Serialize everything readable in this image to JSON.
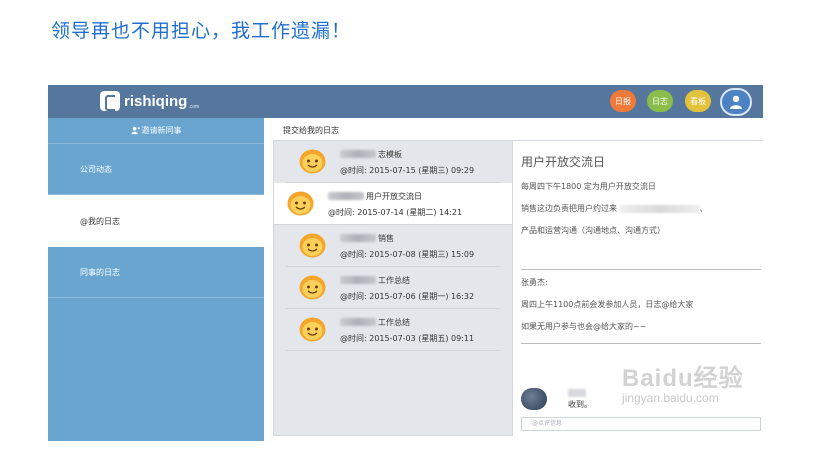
{
  "headline": "领导再也不用担心，我工作遗漏！",
  "topbar": {
    "brand": "rishiqing",
    "brand_suffix": ".com",
    "buttons": [
      "日报",
      "日志",
      "看板"
    ]
  },
  "sidebar": {
    "invite_label": "邀请新同事",
    "items": [
      {
        "label": "公司动态"
      },
      {
        "label": "@我的日志"
      },
      {
        "label": "同事的日志"
      }
    ]
  },
  "list": {
    "title": "提交给我的日志",
    "items": [
      {
        "name": "志模板",
        "time": "@时间: 2015-07-15 (星期三) 09:29"
      },
      {
        "name": "用户开放交流日",
        "time": "@时间: 2015-07-14 (星期二) 14:21"
      },
      {
        "name": "销售",
        "time": "@时间: 2015-07-08 (星期三) 15:09"
      },
      {
        "name": "工作总结",
        "time": "@时间: 2015-07-06 (星期一) 16:32"
      },
      {
        "name": "工作总结",
        "time": "@时间: 2015-07-03 (星期五) 09:11"
      }
    ]
  },
  "detail": {
    "title": "用户开放交流日",
    "line1": "每周四下午1800 定为用户开放交流日",
    "line2_prefix": "销售这边负责把用户约过来",
    "line2_suffix": "、",
    "line3": "产品和运营沟通（沟通地点、沟通方式）",
    "comment_author": "张勇杰:",
    "comment_line1": "周四上午1100点前会发参加人员，日志@给大家",
    "comment_line2": "如果无用户参与也会@给大家的~~",
    "reply_text": "收到。",
    "reply_placeholder": "@点评信息"
  },
  "watermark": {
    "top": "Baidu经验",
    "bottom": "jingyan.baidu.com"
  },
  "colors": {
    "headline": "#1f6fd1",
    "topbar": "#55779d",
    "sidebar": "#6aa5cf",
    "btn_log": "#ef7a3a",
    "btn_journal": "#8bbd4a",
    "btn_board": "#e3c23b"
  }
}
